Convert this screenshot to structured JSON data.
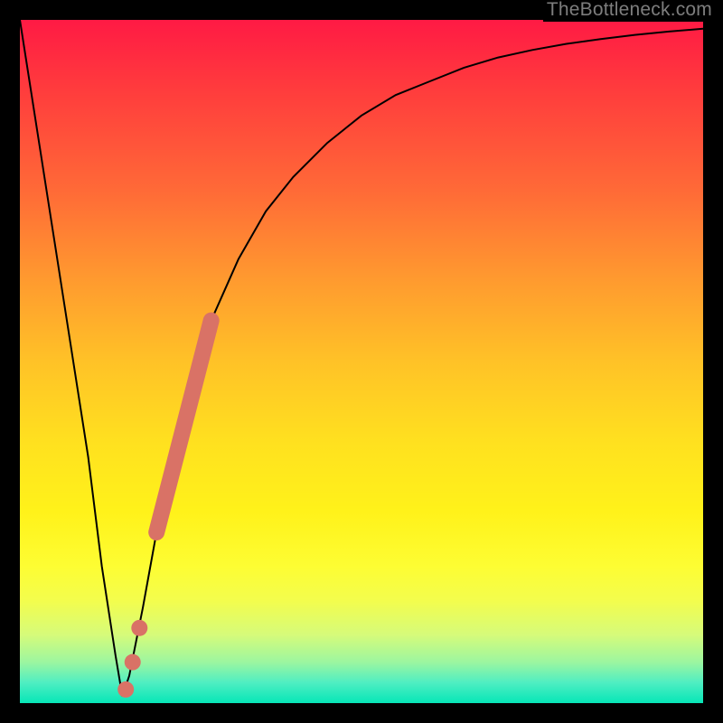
{
  "watermark": "TheBottleneck.com",
  "colors": {
    "frame": "#000000",
    "curve": "#000000",
    "marker": "#d97266",
    "gradient_top": "#ff1a44",
    "gradient_bottom": "#06e6b7"
  },
  "chart_data": {
    "type": "line",
    "title": "",
    "xlabel": "",
    "ylabel": "",
    "xlim": [
      0,
      100
    ],
    "ylim": [
      0,
      100
    ],
    "grid": false,
    "legend": false,
    "series": [
      {
        "name": "bottleneck-curve",
        "x": [
          0,
          5,
          10,
          12,
          14,
          15,
          16,
          18,
          20,
          22,
          25,
          28,
          32,
          36,
          40,
          45,
          50,
          55,
          60,
          65,
          70,
          75,
          80,
          85,
          90,
          95,
          100
        ],
        "values": [
          100,
          68,
          36,
          20,
          7,
          1,
          4,
          14,
          25,
          35,
          47,
          56,
          65,
          72,
          77,
          82,
          86,
          89,
          91,
          93,
          94.5,
          95.6,
          96.5,
          97.2,
          97.8,
          98.3,
          98.7
        ]
      }
    ],
    "markers": [
      {
        "name": "highlight-segment",
        "x": [
          20,
          28
        ],
        "y": [
          25,
          56
        ],
        "shape": "thick-line"
      },
      {
        "name": "highlight-dot-1",
        "x": 17.5,
        "y": 11
      },
      {
        "name": "highlight-dot-2",
        "x": 16.5,
        "y": 6
      },
      {
        "name": "highlight-dot-3",
        "x": 15.5,
        "y": 2
      }
    ]
  }
}
